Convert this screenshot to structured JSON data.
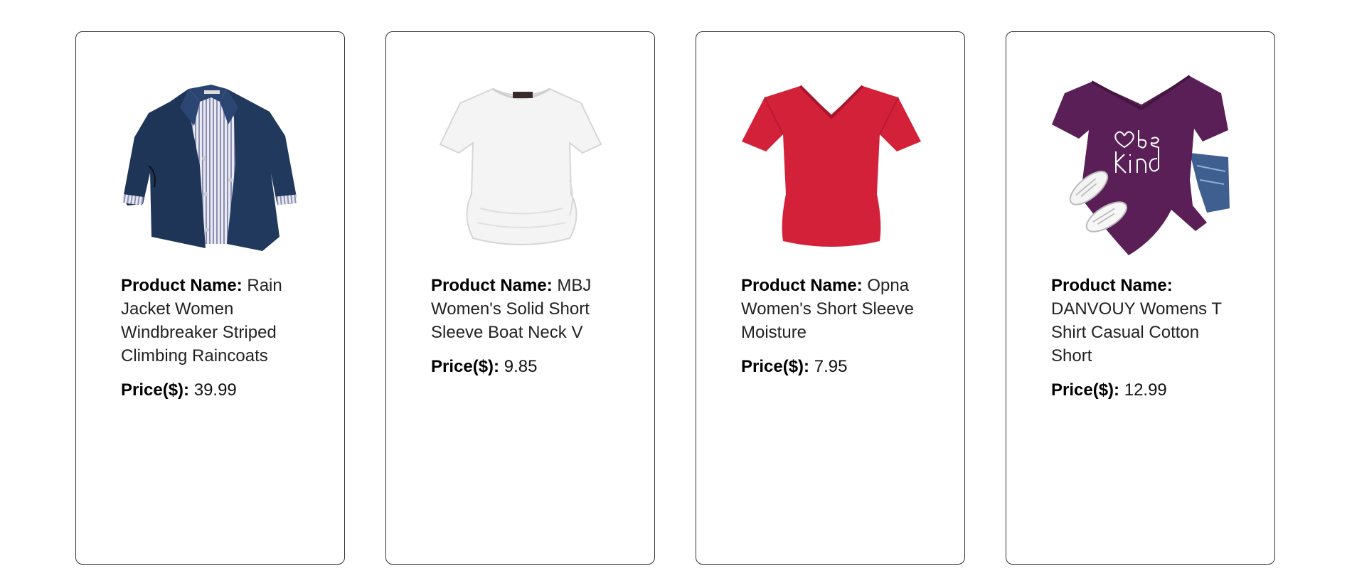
{
  "products": [
    {
      "name_label": "Product Name:",
      "name": "Rain Jacket Women Windbreaker Striped Climbing Raincoats",
      "price_label": "Price($):",
      "price": "39.99",
      "image": "navy-rain-jacket",
      "color": "#1f3558"
    },
    {
      "name_label": "Product Name:",
      "name": "MBJ Women's Solid Short Sleeve Boat Neck V",
      "price_label": "Price($):",
      "price": "9.85",
      "image": "white-tshirt",
      "color": "#f4f4f4"
    },
    {
      "name_label": "Product Name:",
      "name": "Opna Women's Short Sleeve Moisture",
      "price_label": "Price($):",
      "price": "7.95",
      "image": "red-vneck-tshirt",
      "color": "#d4213a"
    },
    {
      "name_label": "Product Name:",
      "name": "DANVOUY Womens T Shirt Casual Cotton Short",
      "price_label": "Price($):",
      "price": "12.99",
      "image": "purple-be-kind-tshirt",
      "color": "#5a1f57",
      "print_text": "be kind"
    }
  ]
}
